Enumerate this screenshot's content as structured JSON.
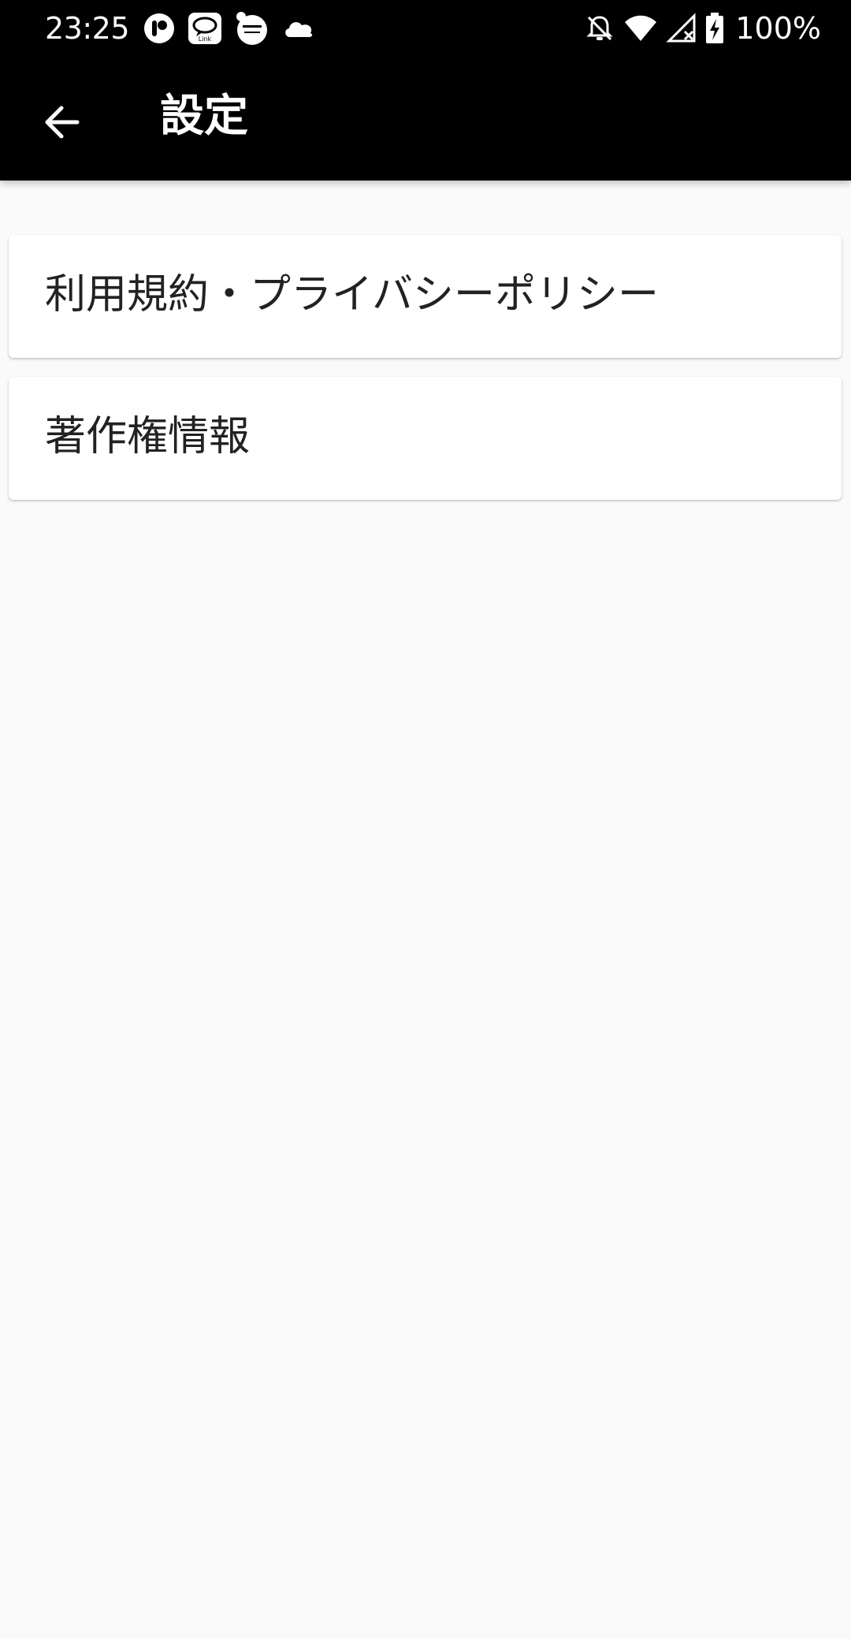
{
  "status_bar": {
    "time": "23:25",
    "battery_percent": "100%",
    "left_icons": [
      "notification-app-icon",
      "link-app-icon",
      "keitai-app-icon",
      "cloud-icon"
    ],
    "right_icons": [
      "notifications-off-icon",
      "wifi-icon",
      "signal-off-icon",
      "battery-charging-icon"
    ]
  },
  "app_bar": {
    "title": "設定",
    "back_icon": "arrow-back-icon"
  },
  "settings_items": [
    {
      "label": "利用規約・プライバシーポリシー"
    },
    {
      "label": "著作権情報"
    }
  ],
  "colors": {
    "app_bar_background": "#000000",
    "page_background": "#fafafa",
    "card_background": "#ffffff",
    "text_primary": "#222222"
  }
}
